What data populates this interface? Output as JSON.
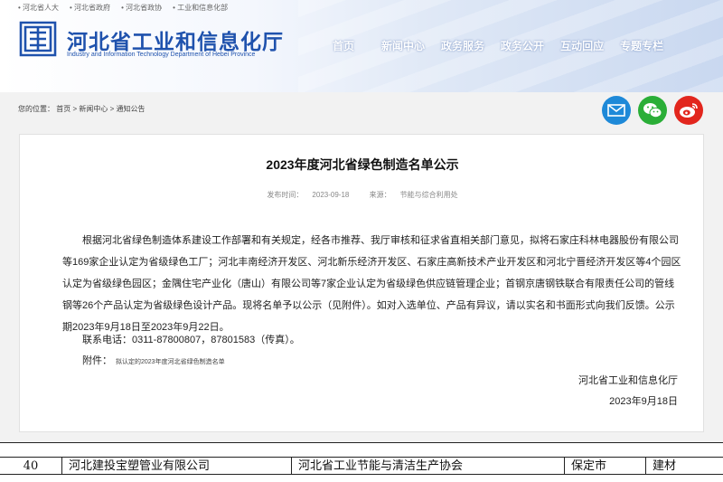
{
  "toplinks": [
    "• 河北省人大",
    "• 河北省政府",
    "• 河北省政协",
    "• 工业和信息化部"
  ],
  "site": {
    "title": "河北省工业和信息化厅",
    "subtitle": "Industry and Information Technology Department of Hebei Province"
  },
  "nav": [
    "首页",
    "新闻中心",
    "政务服务",
    "政务公开",
    "互动回应",
    "专题专栏"
  ],
  "breadcrumb": {
    "prefix": "您的位置：",
    "items": [
      "首页",
      "新闻中心",
      "通知公告"
    ],
    "separator": " > "
  },
  "article": {
    "title": "2023年度河北省绿色制造名单公示",
    "date_label": "发布时间：",
    "date": "2023-09-18",
    "source_label": "来源：",
    "source": "节能与综合利用处",
    "paragraph": "根据河北省绿色制造体系建设工作部署和有关规定，经各市推荐、我厅审核和征求省直相关部门意见，拟将石家庄科林电器股份有限公司等169家企业认定为省级绿色工厂；河北丰南经济开发区、河北新乐经济开发区、石家庄高新技术产业开发区和河北宁晋经济开发区等4个园区认定为省级绿色园区；金隅住宅产业化（唐山）有限公司等7家企业认定为省级绿色供应链管理企业；首钢京唐钢铁联合有限责任公司的管线钢等26个产品认定为省级绿色设计产品。现将名单予以公示（见附件）。如对入选单位、产品有异议，请以实名和书面形式向我们反馈。公示期2023年9月18日至2023年9月22日。",
    "contact": "联系电话：0311-87800807，87801583（传真）。",
    "attachment_label": "附件：",
    "attachment_link": "拟认定的2023年度河北省绿色制造名单",
    "signature_org": "河北省工业和信息化厅",
    "signature_date": "2023年9月18日"
  },
  "table_row": {
    "no": "40",
    "company": "河北建投宝塑管业有限公司",
    "recommender": "河北省工业节能与清洁生产协会",
    "city": "保定市",
    "industry": "建材"
  },
  "colors": {
    "brand_blue": "#1f52ad",
    "mail_icon": "#1e89d8",
    "wechat_icon": "#2aae37",
    "weibo_icon": "#e2261d"
  },
  "icons": [
    "mail-icon",
    "wechat-icon",
    "weibo-icon"
  ]
}
